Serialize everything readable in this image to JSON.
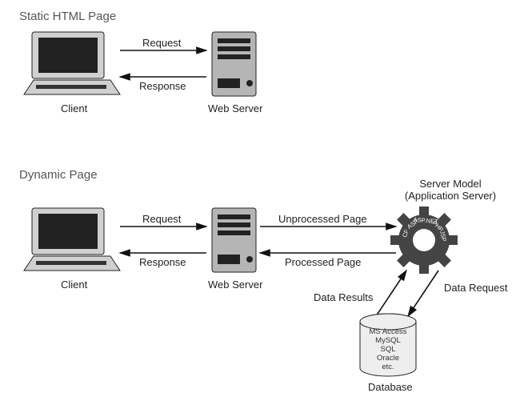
{
  "sections": {
    "static_title": "Static HTML Page",
    "dynamic_title": "Dynamic Page"
  },
  "nodes": {
    "client": "Client",
    "webserver": "Web Server",
    "server_model_line1": "Server Model",
    "server_model_line2": "(Application Server)",
    "database": "Database"
  },
  "arrows": {
    "request": "Request",
    "response": "Response",
    "unprocessed": "Unprocessed Page",
    "processed": "Processed Page",
    "data_request": "Data Request",
    "data_results": "Data Results"
  },
  "gear_tech": [
    "CF",
    "ASP",
    "ASP.NET",
    "PHP",
    "JSP"
  ],
  "db_engines": [
    "MS Access",
    "MySQL",
    "SQL",
    "Oracle",
    "etc."
  ]
}
